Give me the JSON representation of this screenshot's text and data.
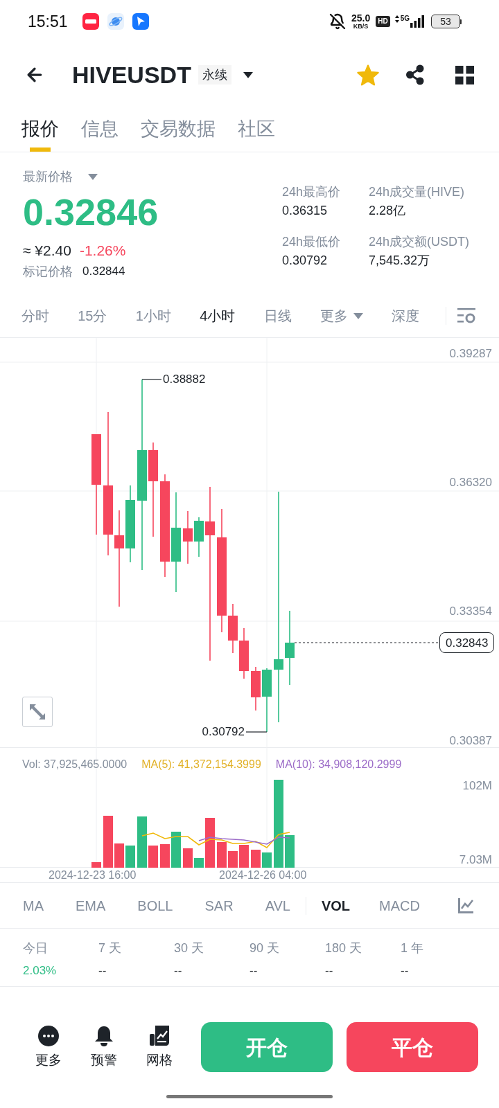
{
  "status_bar": {
    "time": "15:51",
    "speed": "25.0",
    "speed_unit": "KB/S",
    "hd": "HD",
    "network": "5G",
    "battery": "53"
  },
  "header": {
    "symbol": "HIVEUSDT",
    "tag": "永续",
    "favorite": true
  },
  "tabs": [
    {
      "label": "报价",
      "selected": true
    },
    {
      "label": "信息",
      "selected": false
    },
    {
      "label": "交易数据",
      "selected": false
    },
    {
      "label": "社区",
      "selected": false
    }
  ],
  "price": {
    "label": "最新价格",
    "last": "0.32846",
    "fiat": "≈ ¥2.40",
    "change": "-1.26%",
    "mark_label": "标记价格",
    "mark": "0.32844"
  },
  "stats": [
    {
      "label": "24h最高价",
      "value": "0.36315"
    },
    {
      "label": "24h成交量(HIVE)",
      "value": "2.28亿"
    },
    {
      "label": "24h最低价",
      "value": "0.30792"
    },
    {
      "label": "24h成交额(USDT)",
      "value": "7,545.32万"
    }
  ],
  "intervals": [
    {
      "label": "分时",
      "kind": "interval",
      "selected": false
    },
    {
      "label": "15分",
      "kind": "interval",
      "selected": false
    },
    {
      "label": "1小时",
      "kind": "interval",
      "selected": false
    },
    {
      "label": "4小时",
      "kind": "interval",
      "selected": true
    },
    {
      "label": "日线",
      "kind": "interval",
      "selected": false
    },
    {
      "label": "更多",
      "kind": "dropdown",
      "selected": false
    },
    {
      "label": "深度",
      "kind": "interval",
      "selected": false
    }
  ],
  "chart": {
    "price_axis": [
      "0.39287",
      "0.36320",
      "0.33354",
      "0.30387"
    ],
    "high_marker": "0.38882",
    "low_marker": "0.30792",
    "last_price": "0.32843"
  },
  "volume": {
    "vol": "Vol: 37,925,465.0000",
    "ma5": "MA(5): 41,372,154.3999",
    "ma10": "MA(10): 34,908,120.2999",
    "axis": [
      "102M",
      "7.03M"
    ],
    "time_axis": [
      "2024-12-23 16:00",
      "2024-12-26 04:00"
    ]
  },
  "indicators": {
    "main": [
      {
        "label": "MA",
        "selected": false
      },
      {
        "label": "EMA",
        "selected": false
      },
      {
        "label": "BOLL",
        "selected": false
      },
      {
        "label": "SAR",
        "selected": false
      },
      {
        "label": "AVL",
        "selected": false
      }
    ],
    "sub": [
      {
        "label": "VOL",
        "selected": true
      },
      {
        "label": "MACD",
        "selected": false
      }
    ]
  },
  "performance": [
    {
      "period": "今日",
      "value": "2.03%",
      "color": "#2ebd85"
    },
    {
      "period": "7 天",
      "value": "--",
      "color": "#1e2329"
    },
    {
      "period": "30 天",
      "value": "--",
      "color": "#1e2329"
    },
    {
      "period": "90 天",
      "value": "--",
      "color": "#1e2329"
    },
    {
      "period": "180 天",
      "value": "--",
      "color": "#1e2329"
    },
    {
      "period": "1 年",
      "value": "--",
      "color": "#1e2329"
    }
  ],
  "bottom_bar": {
    "actions": [
      {
        "kind": "more",
        "label": "更多"
      },
      {
        "kind": "alert",
        "label": "预警"
      },
      {
        "kind": "grid",
        "label": "网格"
      }
    ],
    "open_button": "开仓",
    "close_button": "平仓"
  }
}
